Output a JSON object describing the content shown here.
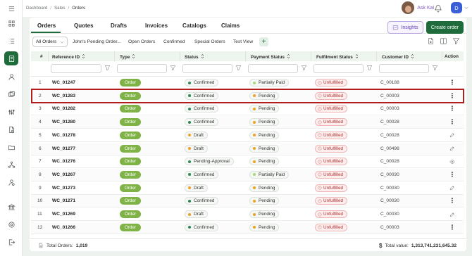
{
  "breadcrumb": [
    "Dashboard",
    "Sales",
    "Orders"
  ],
  "header": {
    "assistant_label": "Ask Kai",
    "user_initial": "D"
  },
  "sidebar": {
    "items": [
      {
        "icon": "menu-icon"
      },
      {
        "icon": "dashboard-icon"
      },
      {
        "icon": "list-icon"
      },
      {
        "icon": "orders-icon",
        "active": true
      },
      {
        "icon": "user-icon"
      },
      {
        "icon": "layers-icon"
      },
      {
        "icon": "sliders-icon"
      },
      {
        "icon": "document-icon"
      },
      {
        "icon": "folder-icon"
      },
      {
        "icon": "network-icon"
      },
      {
        "icon": "person-settings-icon"
      },
      {
        "icon": "bank-icon"
      },
      {
        "icon": "settings-icon"
      },
      {
        "icon": "logout-icon"
      }
    ]
  },
  "tabs": [
    "Orders",
    "Quotes",
    "Drafts",
    "Invoices",
    "Catalogs",
    "Claims"
  ],
  "buttons": {
    "insights": "Insights",
    "create_order": "Create order"
  },
  "filter_bar": {
    "selected_view": "All Orders",
    "views": [
      "John's Pending Order...",
      "Open Orders",
      "Confirmed",
      "Special Orders",
      "Test View"
    ]
  },
  "table": {
    "columns": [
      "#",
      "Reference ID",
      "Type",
      "Status",
      "Payment Status",
      "Fulfilment Status",
      "Customer ID",
      "Action"
    ],
    "rows": [
      {
        "n": "1",
        "ref": "WC_01247",
        "type": "Order",
        "status": "Confirmed",
        "payment": "Partially Paid",
        "fulfilment": "Unfulfilled",
        "customer": "C_00188",
        "action": "more"
      },
      {
        "n": "2",
        "ref": "WC_01283",
        "type": "Order",
        "status": "Confirmed",
        "payment": "Pending",
        "fulfilment": "Unfulfilled",
        "customer": "C_00003",
        "action": "more"
      },
      {
        "n": "3",
        "ref": "WC_01282",
        "type": "Order",
        "status": "Confirmed",
        "payment": "Pending",
        "fulfilment": "Unfulfilled",
        "customer": "C_00003",
        "action": "more"
      },
      {
        "n": "4",
        "ref": "WC_01280",
        "type": "Order",
        "status": "Confirmed",
        "payment": "Pending",
        "fulfilment": "Unfulfilled",
        "customer": "C_00028",
        "action": "more"
      },
      {
        "n": "5",
        "ref": "WC_01278",
        "type": "Order",
        "status": "Draft",
        "payment": "Pending",
        "fulfilment": "Unfulfilled",
        "customer": "C_00028",
        "action": "edit"
      },
      {
        "n": "6",
        "ref": "WC_01277",
        "type": "Order",
        "status": "Draft",
        "payment": "Pending",
        "fulfilment": "Unfulfilled",
        "customer": "C_00498",
        "action": "edit"
      },
      {
        "n": "7",
        "ref": "WC_01276",
        "type": "Order",
        "status": "Pending-Approval",
        "payment": "Pending",
        "fulfilment": "Unfulfilled",
        "customer": "C_00028",
        "action": "view"
      },
      {
        "n": "8",
        "ref": "WC_01267",
        "type": "Order",
        "status": "Confirmed",
        "payment": "Partially Paid",
        "fulfilment": "Unfulfilled",
        "customer": "C_00030",
        "action": "more"
      },
      {
        "n": "9",
        "ref": "WC_01273",
        "type": "Order",
        "status": "Draft",
        "payment": "Pending",
        "fulfilment": "Unfulfilled",
        "customer": "C_00030",
        "action": "edit"
      },
      {
        "n": "10",
        "ref": "WC_01271",
        "type": "Order",
        "status": "Confirmed",
        "payment": "Pending",
        "fulfilment": "Unfulfilled",
        "customer": "C_00030",
        "action": "more"
      },
      {
        "n": "11",
        "ref": "WC_01269",
        "type": "Order",
        "status": "Draft",
        "payment": "Pending",
        "fulfilment": "Unfulfilled",
        "customer": "C_00030",
        "action": "edit"
      },
      {
        "n": "12",
        "ref": "WC_01266",
        "type": "Order",
        "status": "Confirmed",
        "payment": "Pending",
        "fulfilment": "Unfulfilled",
        "customer": "C_00003",
        "action": "more"
      }
    ],
    "highlighted_row": "2"
  },
  "footer": {
    "total_orders_label": "Total Orders:",
    "total_orders_value": "1,019",
    "total_value_label": "Total value:",
    "total_value_value": "1,313,741,231,645.32"
  },
  "colors": {
    "brand": "#1f6b3c",
    "order_pill": "#7fb347",
    "confirmed_dot": "#2e8b57",
    "draft_dot": "#f0a020",
    "pending_dot": "#f0a020",
    "partially_paid_dot": "#a3d977",
    "pending_approval_dot": "#2e8b57",
    "unfulfilled": "#b13232",
    "highlight_border": "#b41d1d",
    "insights": "#5f3fb8"
  }
}
